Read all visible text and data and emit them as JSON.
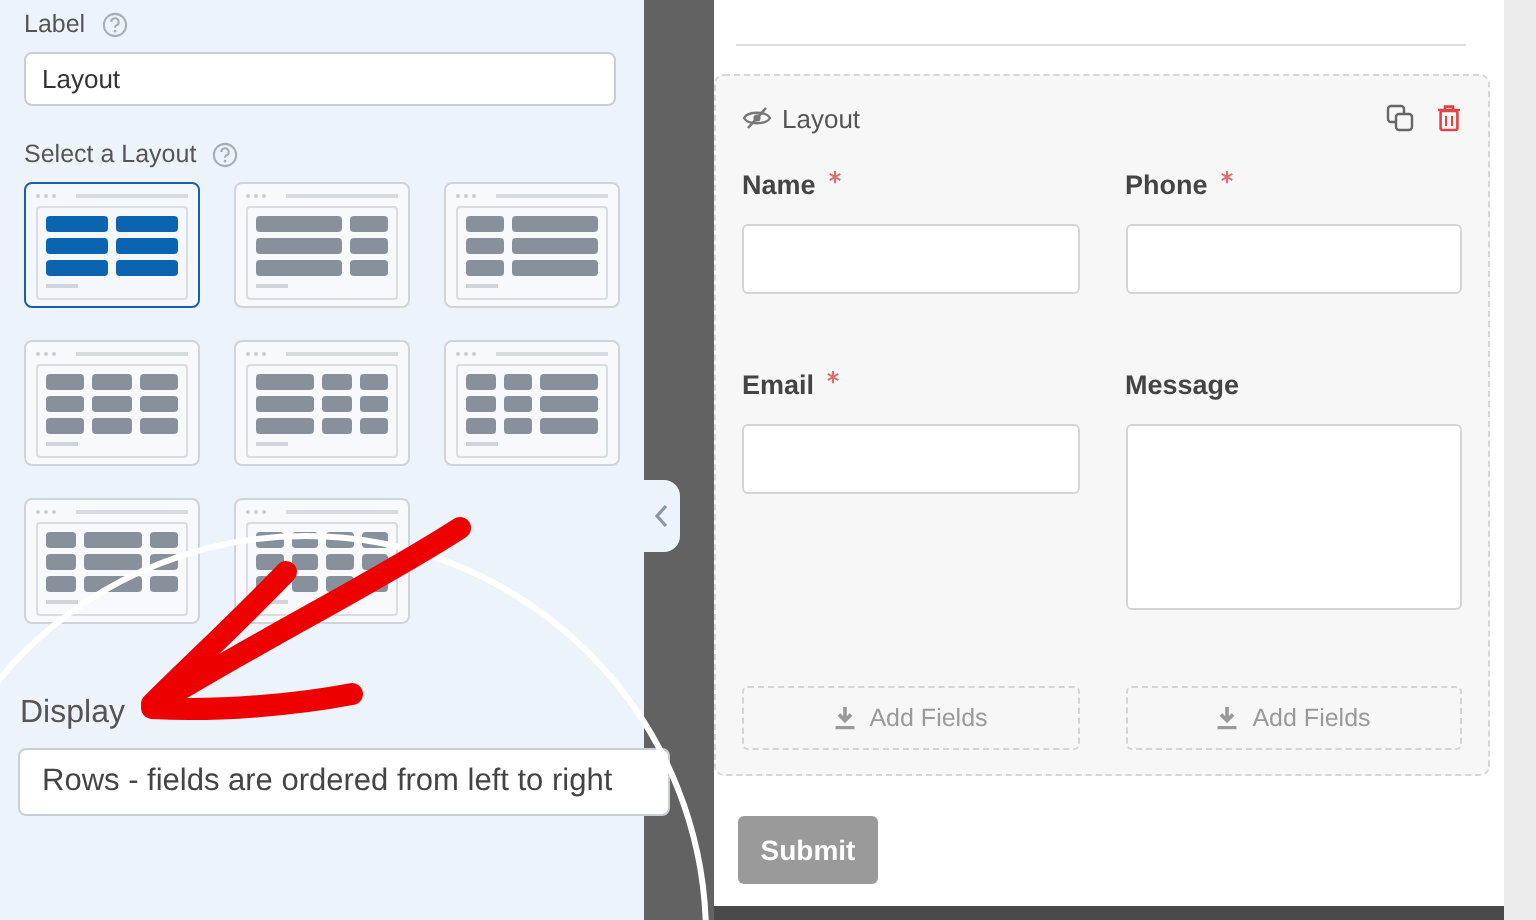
{
  "settings": {
    "label_field": {
      "label": "Label",
      "value": "Layout"
    },
    "layout_picker": {
      "label": "Select a Layout",
      "options": [
        {
          "kind": "halves",
          "selected": true
        },
        {
          "kind": "wide-narrow",
          "selected": false
        },
        {
          "kind": "narrow-wide",
          "selected": false
        },
        {
          "kind": "thirds",
          "selected": false
        },
        {
          "kind": "wide-quarters",
          "selected": false
        },
        {
          "kind": "quarters-wide",
          "selected": false
        },
        {
          "kind": "quarter-half-quarter",
          "selected": false
        },
        {
          "kind": "fourths",
          "selected": false
        }
      ]
    },
    "display_field": {
      "label": "Display",
      "value": "Rows - fields are ordered from left to right"
    }
  },
  "preview": {
    "layout_block": {
      "title": "Layout",
      "columns": [
        {
          "fields": [
            {
              "label": "Name",
              "required": true,
              "kind": "text"
            },
            {
              "label": "Email",
              "required": true,
              "kind": "text"
            }
          ],
          "add_button": "Add Fields"
        },
        {
          "fields": [
            {
              "label": "Phone",
              "required": true,
              "kind": "text"
            },
            {
              "label": "Message",
              "required": false,
              "kind": "textarea"
            }
          ],
          "add_button": "Add Fields"
        }
      ]
    },
    "submit_button": "Submit"
  }
}
